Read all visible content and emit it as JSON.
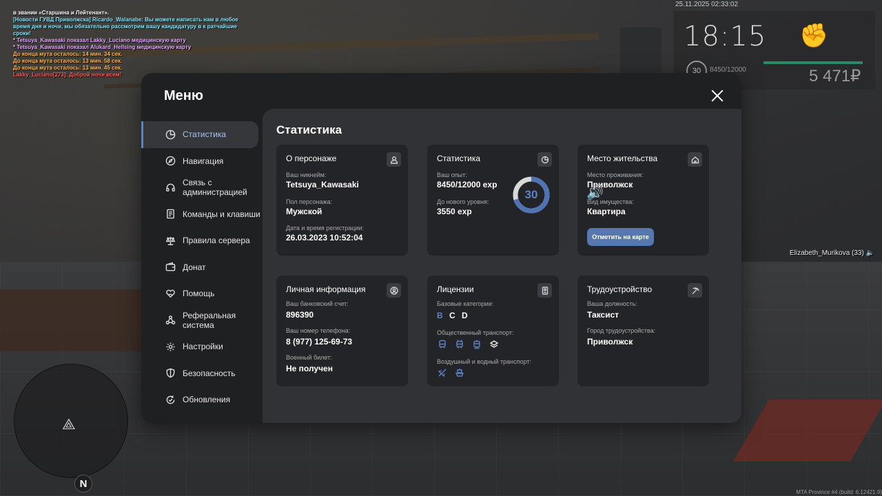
{
  "chat": [
    {
      "text": " в звании «Старшина и Лейтенант».",
      "color": "white"
    },
    {
      "text": "[Новости ГУВД Приволжска] Ricardo_Walanabe: Вы можете написать нам в любое время дня и ночи, мы обязательно рассмотрим вашу кандидатуру в к ратчайшие сроки!",
      "color": "cyan"
    },
    {
      "text": " * Tetsuya_Kawasaki показал Lakky_Luciano медицинскую карту",
      "color": "pink"
    },
    {
      "text": " * Tetsuya_Kawasaki показал Alukard_Hellsing медицинскую карту",
      "color": "pink"
    },
    {
      "text": "До конца мута осталось: 14 мин. 34 сек.",
      "color": "orange"
    },
    {
      "text": "До конца мута осталось: 13 мин. 58 сек.",
      "color": "orange"
    },
    {
      "text": "До конца мута осталось: 13 мин. 45 сек.",
      "color": "orange"
    },
    {
      "text": "Lakky_Luciano[273]: Доброй ночи всем!",
      "color": "red"
    }
  ],
  "hud": {
    "datetime": "25.11.2025 02:33:02",
    "time": "18:15",
    "level": "30",
    "exp": "8450/12000",
    "money": "5 471₽",
    "nearby_player": "Elizabeth_Murikova (33)",
    "compass": "N",
    "build": "MTA Province #4 (build: 6.12421.9)"
  },
  "menu": {
    "title": "Меню",
    "nav": [
      {
        "label": "Статистика",
        "icon": "pie-chart-icon",
        "active": true
      },
      {
        "label": "Навигация",
        "icon": "compass-icon"
      },
      {
        "label": "Связь с администрацией",
        "icon": "headset-icon"
      },
      {
        "label": "Команды и клавиши",
        "icon": "document-icon"
      },
      {
        "label": "Правила сервера",
        "icon": "scales-icon"
      },
      {
        "label": "Донат",
        "icon": "wallet-icon"
      },
      {
        "label": "Помощь",
        "icon": "heart-hand-icon"
      },
      {
        "label": "Реферальная система",
        "icon": "network-icon"
      },
      {
        "label": "Настройки",
        "icon": "gear-icon"
      },
      {
        "label": "Безопасность",
        "icon": "shield-icon"
      },
      {
        "label": "Обновления",
        "icon": "refresh-icon"
      }
    ],
    "content_title": "Статистика",
    "character": {
      "title": "О персонаже",
      "nick_label": "Ваш никнейм:",
      "nick": "Tetsuya_Kawasaki",
      "gender_label": "Пол персонажа:",
      "gender": "Мужской",
      "reg_label": "Дата и время регистрации:",
      "reg": "26.03.2023 10:52:04"
    },
    "stats": {
      "title": "Статистика",
      "exp_label": "Ваш опыт:",
      "exp": "8450/12000 exp",
      "next_label": "До нового уровня:",
      "next": "3550 exp",
      "level": "30",
      "progress": 0.704
    },
    "residence": {
      "title": "Место жительства",
      "place_label": "Место проживания:",
      "place": "Приволжск",
      "type_label": "Вид имущества:",
      "type": "Квартира",
      "button": "Отметить на карте"
    },
    "personal": {
      "title": "Личная информация",
      "bank_label": "Ваш банковский счет:",
      "bank": "896390",
      "phone_label": "Ваш номер телефона:",
      "phone": "8 (977) 125-69-73",
      "military_label": "Военный билет:",
      "military": "Не получен"
    },
    "licenses": {
      "title": "Лицензии",
      "base_label": "Базовые категории:",
      "categories": [
        {
          "name": "B",
          "owned": true
        },
        {
          "name": "C",
          "owned": false
        },
        {
          "name": "D",
          "owned": false
        }
      ],
      "public_label": "Общественный транспорт:",
      "air_label": "Воздушный и водный транспорт:"
    },
    "job": {
      "title": "Трудоустройство",
      "position_label": "Ваша должность:",
      "position": "Таксист",
      "city_label": "Город трудоустройства:",
      "city": "Приволжск"
    }
  },
  "colors": {
    "accent": "#5b82c7",
    "panel": "#1f2022",
    "card": "#232427",
    "content": "#313235"
  }
}
